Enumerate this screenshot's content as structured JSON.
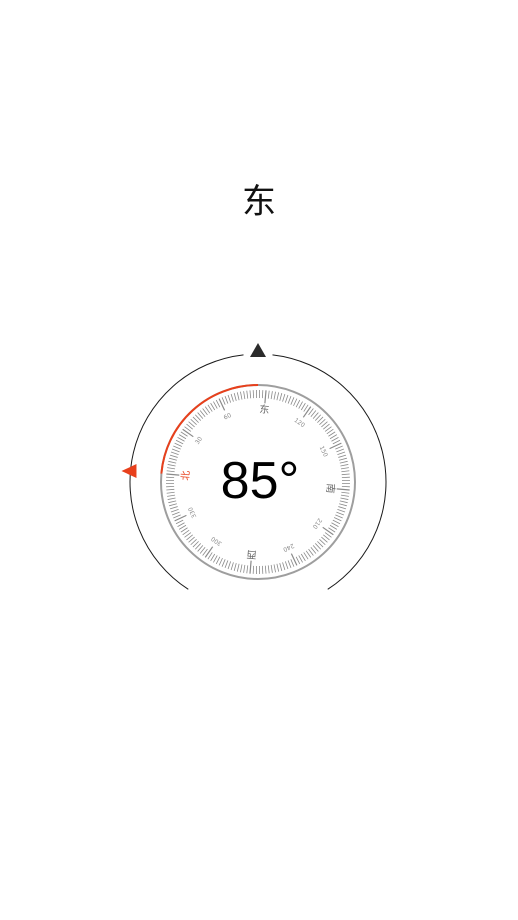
{
  "direction": {
    "label": "东"
  },
  "heading": {
    "degrees": 85,
    "display": "85°"
  },
  "dial": {
    "cardinals": {
      "north": "北",
      "east": "东",
      "south": "南",
      "west": "西"
    },
    "degree_labels": [
      "30",
      "60",
      "120",
      "150",
      "210",
      "240",
      "300",
      "330"
    ]
  },
  "colors": {
    "accent": "#e8401c",
    "outer_ring": "#1a1a1a",
    "inner_ring": "#9e9e9e",
    "ticks": "#8a8a8a",
    "pointer": "#2b2b2b",
    "text": "#000000"
  }
}
